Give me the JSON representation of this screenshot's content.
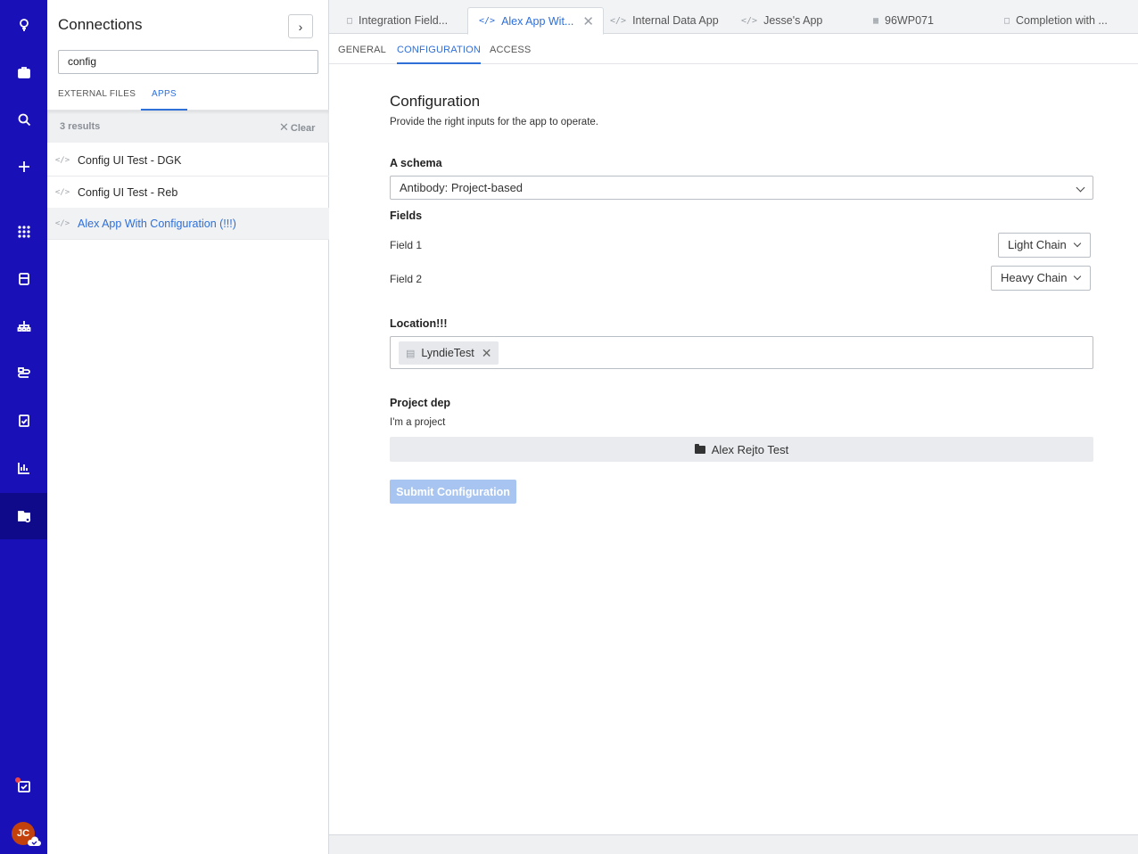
{
  "rail": {
    "items": [
      "balloon-icon",
      "briefcase-icon",
      "search-icon",
      "plus-icon",
      "grid-icon",
      "database-icon",
      "hierarchy-icon",
      "workflow-icon",
      "checklist-icon",
      "chart-icon",
      "folder-settings-icon"
    ],
    "bottom": [
      "tasks-icon"
    ],
    "avatar_initials": "JC"
  },
  "panel": {
    "title": "Connections",
    "search_value": "config",
    "tabs": [
      "EXTERNAL FILES",
      "APPS"
    ],
    "active_tab": "APPS",
    "results_count": "3 results",
    "clear_label": "Clear",
    "results": [
      {
        "label": "Config UI Test - DGK"
      },
      {
        "label": "Config UI Test - Reb"
      },
      {
        "label": "Alex App With Configuration (!!!)"
      }
    ]
  },
  "tabs": [
    {
      "label": "Integration Field...",
      "icon": "document-icon"
    },
    {
      "label": "Alex App Wit...",
      "icon": "code-icon"
    },
    {
      "label": "Internal Data App",
      "icon": "code-icon"
    },
    {
      "label": "Jesse's App",
      "icon": "code-icon"
    },
    {
      "label": "96WP071",
      "icon": "plate-icon"
    },
    {
      "label": "Completion with ...",
      "icon": "document-icon"
    }
  ],
  "subtabs": [
    "GENERAL",
    "CONFIGURATION",
    "ACCESS"
  ],
  "config": {
    "title": "Configuration",
    "subtitle": "Provide the right inputs for the app to operate.",
    "schema_label": "A schema",
    "schema_value": "Antibody: Project-based",
    "fields_label": "Fields",
    "field1_label": "Field 1",
    "field1_value": "Light Chain",
    "field2_label": "Field 2",
    "field2_value": "Heavy Chain",
    "location_label": "Location!!!",
    "location_chip": "LyndieTest",
    "project_label": "Project dep",
    "project_sub": "I'm a project",
    "project_value": "Alex Rejto Test",
    "submit_label": "Submit Configuration"
  },
  "colors": {
    "rail": "#1a10b8",
    "accent": "#2e6fd8",
    "submit_disabled": "#a8c4f0"
  }
}
